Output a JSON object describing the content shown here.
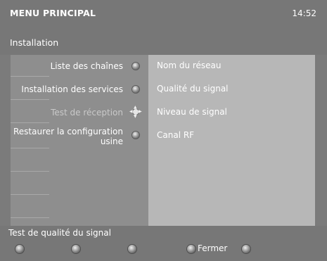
{
  "header": {
    "title": "MENU PRINCIPAL",
    "clock": "14:52",
    "section": "Installation"
  },
  "menu": {
    "items": [
      {
        "label": "Liste des chaînes",
        "icon": "button-icon"
      },
      {
        "label": "Installation des services",
        "icon": "button-icon"
      },
      {
        "label": "Test de réception",
        "icon": "navigation-cross-icon",
        "state": "selected"
      },
      {
        "label_line1": "Restaurer la configuration",
        "label_line2": "usine",
        "icon": "button-icon"
      }
    ]
  },
  "details": {
    "items": [
      "Nom du réseau",
      "Qualité du signal",
      "Niveau de signal",
      "Canal RF"
    ]
  },
  "footer": {
    "status": "Test de qualité du signal",
    "close_label": "Fermer"
  }
}
